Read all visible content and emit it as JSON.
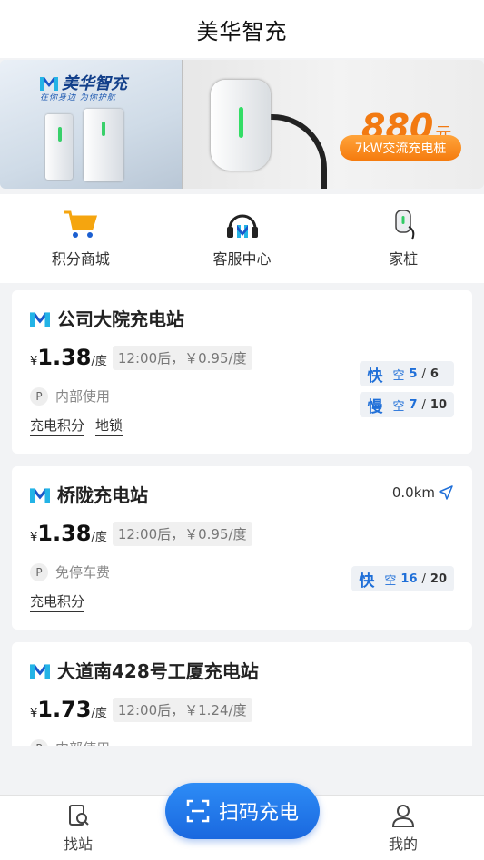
{
  "header": {
    "title": "美华智充"
  },
  "banner": {
    "brand": "美华智充",
    "slogan": "在你身边 为你护航",
    "price_value": "880",
    "price_unit": "元",
    "tag": "7kW交流充电桩"
  },
  "quick_links": [
    {
      "label": "积分商城",
      "icon": "shopping-cart-icon"
    },
    {
      "label": "客服中心",
      "icon": "headset-icon"
    },
    {
      "label": "家桩",
      "icon": "home-charger-icon"
    }
  ],
  "stations": [
    {
      "name": "公司大院充电站",
      "currency": "¥",
      "price": "1.38",
      "unit": "/度",
      "later_price": "12:00后，￥0.95/度",
      "parking": "内部使用",
      "tags": [
        "充电积分",
        "地锁"
      ],
      "ports": [
        {
          "type": "快",
          "free_label": "空",
          "free": "5",
          "total": "6"
        },
        {
          "type": "慢",
          "free_label": "空",
          "free": "7",
          "total": "10"
        }
      ]
    },
    {
      "name": "桥陇充电站",
      "distance": "0.0km",
      "currency": "¥",
      "price": "1.38",
      "unit": "/度",
      "later_price": "12:00后，￥0.95/度",
      "parking": "免停车费",
      "tags": [
        "充电积分"
      ],
      "ports": [
        {
          "type": "快",
          "free_label": "空",
          "free": "16",
          "total": "20"
        }
      ]
    },
    {
      "name": "大道南428号工厦充电站",
      "currency": "¥",
      "price": "1.73",
      "unit": "/度",
      "later_price": "12:00后，￥1.24/度",
      "parking": "内部使用"
    }
  ],
  "bottom_nav": {
    "find": "找站",
    "scan": "扫码充电",
    "mine": "我的"
  },
  "colors": {
    "accent": "#1f6fd8",
    "orange": "#f27a12"
  }
}
